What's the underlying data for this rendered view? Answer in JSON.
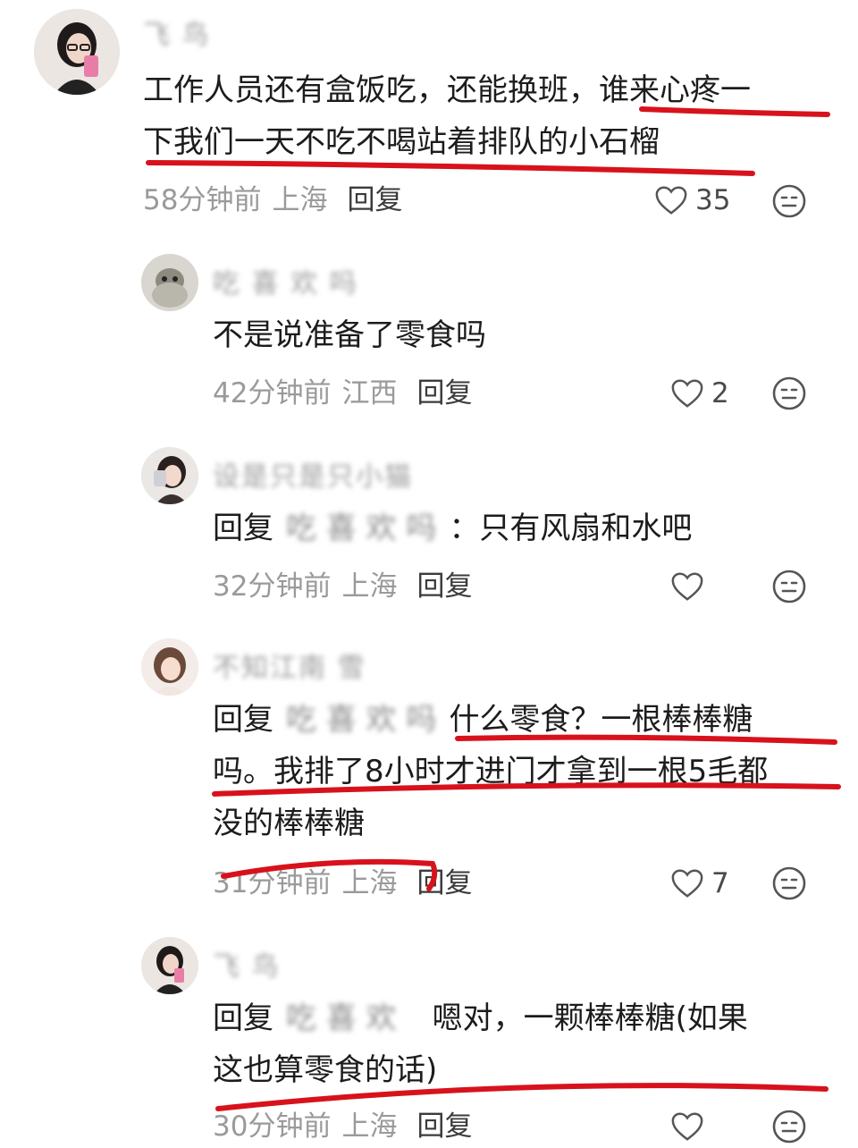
{
  "comments": [
    {
      "username": "飞 鸟",
      "text_lines": [
        "工作人员还有盒饭吃，还能换班，谁来心疼一",
        "下我们一天不吃不喝站着排队的小石榴"
      ],
      "time": "58分钟前",
      "location": "上海",
      "reply_label": "回复",
      "likes": "35"
    },
    {
      "username": "吃 喜 欢 吗",
      "text_lines": [
        "不是说准备了零食吗"
      ],
      "time": "42分钟前",
      "location": "江西",
      "reply_label": "回复",
      "likes": "2"
    },
    {
      "username": "设是只是只小猫",
      "reply_prefix": "回复",
      "reply_target": "吃 喜 欢 吗",
      "text_lines": [
        "：只有风扇和水吧"
      ],
      "time": "32分钟前",
      "location": "上海",
      "reply_label": "回复",
      "likes": ""
    },
    {
      "username": "不知江南 雪",
      "reply_prefix": "回复",
      "reply_target": "吃 喜 欢 吗",
      "text_lines": [
        "什么零食？一根棒棒糖",
        "吗。我排了8小时才进门才拿到一根5毛都",
        "没的棒棒糖"
      ],
      "time": "31分钟前",
      "location": "上海",
      "reply_label": "回复",
      "likes": "7"
    },
    {
      "username": "飞 鸟",
      "reply_prefix": "回复",
      "reply_target": "吃 喜 欢",
      "text_lines": [
        "嗯对，一颗棒棒糖(如果",
        "这也算零食的话)"
      ],
      "time": "30分钟前",
      "location": "上海",
      "reply_label": "回复",
      "likes": ""
    }
  ],
  "colors": {
    "annotation_red": "#d8121c",
    "meta_gray": "#9a9a9a",
    "text": "#1c1c1c"
  },
  "icons": {
    "like": "heart-outline-icon",
    "dislike": "neutral-face-icon"
  }
}
